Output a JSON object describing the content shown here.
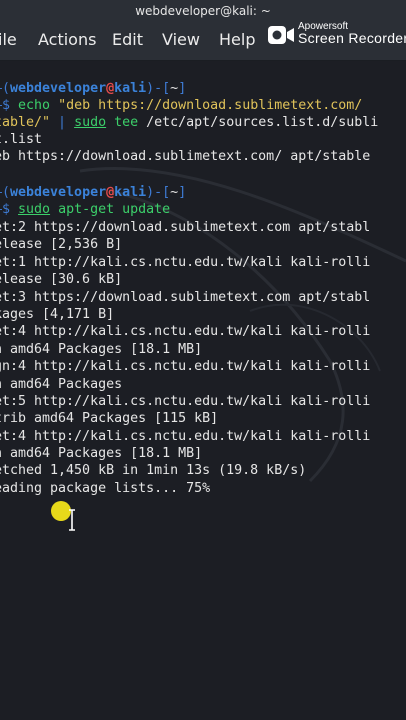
{
  "window": {
    "title": "webdeveloper@kali: ~"
  },
  "menu": [
    {
      "label": "ile"
    },
    {
      "label": "Actions"
    },
    {
      "label": "Edit"
    },
    {
      "label": "View"
    },
    {
      "label": "Help"
    }
  ],
  "watermark": {
    "brand": "Apowersoft",
    "product": "Screen Recorder"
  },
  "terminal": {
    "prompt1": {
      "corner": "—(",
      "user": "webdeveloper",
      "at": "@",
      "host": "kali",
      "sep": ")-[",
      "dir": "~",
      "end": "]"
    },
    "cmd1": {
      "arrow": "—$ ",
      "line1_cmd": "echo",
      "line1_rest": " \"deb https://download.sublimetext.com/",
      "line2_str": "table/\"",
      "line2_pipe": " | ",
      "line2_sudo": "sudo",
      "line2_tee": " tee",
      "line2_path": " /etc/apt/sources.list.d/subli",
      "line3": "t.list",
      "line4": "eb https://download.sublimetext.com/ apt/stable"
    },
    "prompt2": {
      "corner": "—(",
      "user": "webdeveloper",
      "at": "@",
      "host": "kali",
      "sep": ")-[",
      "dir": "~",
      "end": "]"
    },
    "cmd2": {
      "arrow": "—$ ",
      "sudo": "sudo",
      "rest": " apt-get update"
    },
    "output": [
      "et:2 https://download.sublimetext.com apt/stabl",
      "elease [2,536 B]",
      "et:1 http://kali.cs.nctu.edu.tw/kali kali-rolli",
      "elease [30.6 kB]",
      "et:3 https://download.sublimetext.com apt/stabl",
      "kages [4,171 B]",
      "et:4 http://kali.cs.nctu.edu.tw/kali kali-rolli",
      "n amd64 Packages [18.1 MB]",
      "gn:4 http://kali.cs.nctu.edu.tw/kali kali-rolli",
      "n amd64 Packages",
      "et:5 http://kali.cs.nctu.edu.tw/kali kali-rolli",
      "trib amd64 Packages [115 kB]",
      "et:4 http://kali.cs.nctu.edu.tw/kali kali-rolli",
      "n amd64 Packages [18.1 MB]",
      "etched 1,450 kB in 1min 13s (19.8 kB/s)",
      "eading package lists... 75%"
    ]
  },
  "colors": {
    "prompt_frame": "#3e7bd3",
    "user": "#3b82d9",
    "host_marker": "#e34b4b",
    "command": "#3ccf6a",
    "string": "#e0c35a",
    "cursor_highlight": "#f2e41a"
  }
}
